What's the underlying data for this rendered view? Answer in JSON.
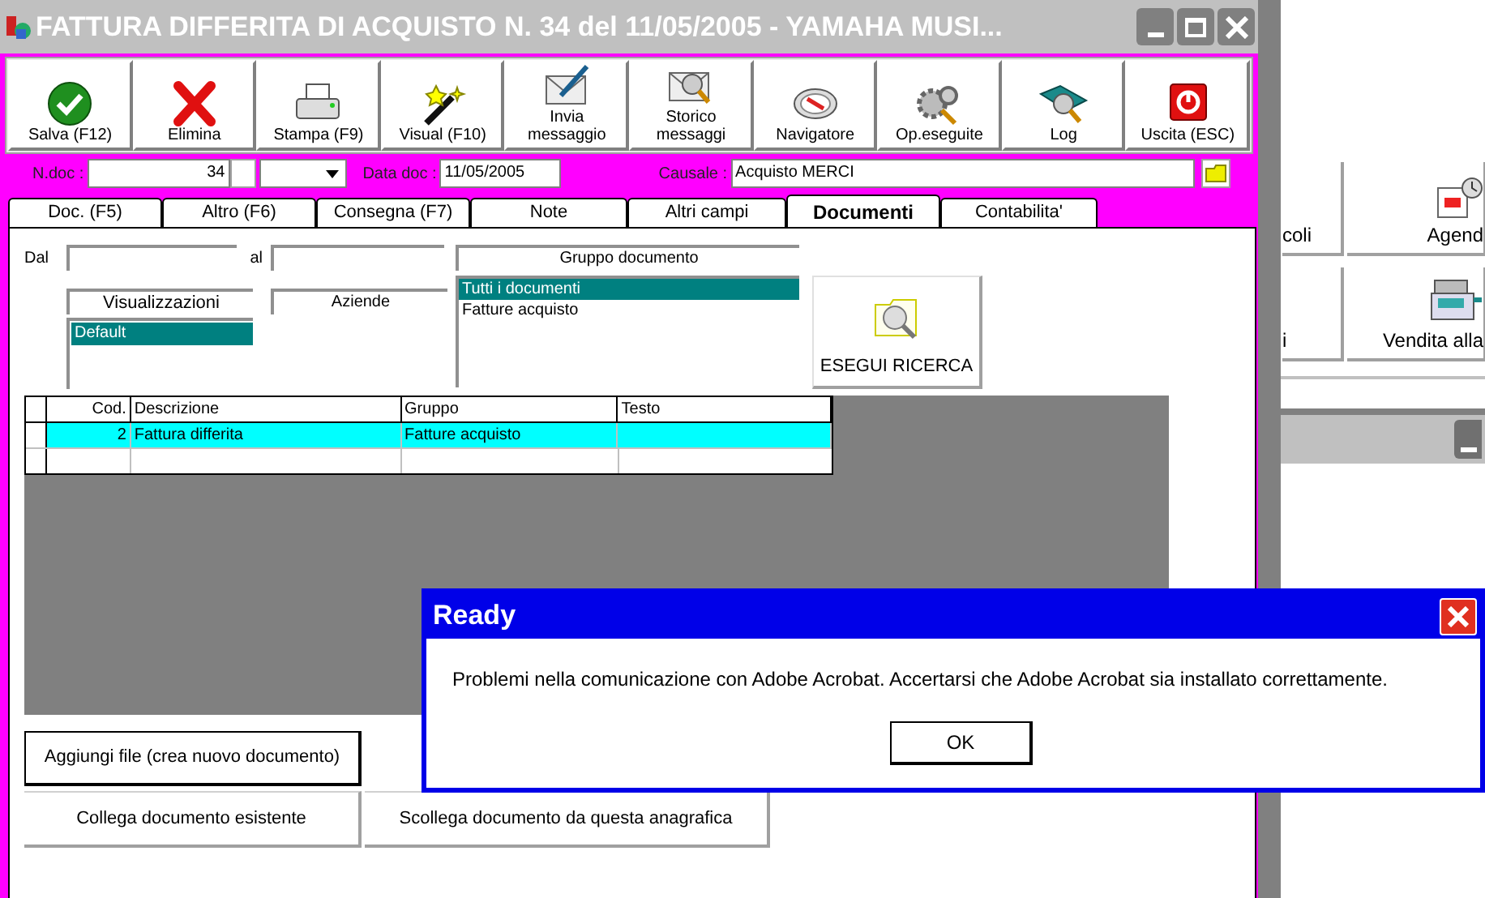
{
  "window": {
    "title": "FATTURA DIFFERITA DI ACQUISTO N. 34  del 11/05/2005 - YAMAHA MUSI..."
  },
  "toolbar": [
    {
      "label": "Salva (F12)",
      "kind": "check"
    },
    {
      "label": "Elimina",
      "kind": "cross"
    },
    {
      "label": "Stampa (F9)",
      "kind": "printer"
    },
    {
      "label": "Visual (F10)",
      "kind": "wand"
    },
    {
      "label": "Invia messaggio",
      "kind": "mail"
    },
    {
      "label": "Storico messaggi",
      "kind": "mailsearch"
    },
    {
      "label": "Navigatore",
      "kind": "compass"
    },
    {
      "label": "Op.eseguite",
      "kind": "gears"
    },
    {
      "label": "Log",
      "kind": "book"
    },
    {
      "label": "Uscita (ESC)",
      "kind": "power"
    }
  ],
  "header": {
    "ndoc_label": "N.doc :",
    "ndoc": "34",
    "date_label": "Data doc :",
    "date": "11/05/2005",
    "causale_label": "Causale :",
    "causale": "Acquisto MERCI"
  },
  "tabs": [
    {
      "label": "Doc. (F5)",
      "selected": false
    },
    {
      "label": "Altro (F6)",
      "selected": false
    },
    {
      "label": "Consegna (F7)",
      "selected": false
    },
    {
      "label": "Note",
      "selected": false
    },
    {
      "label": "Altri campi",
      "selected": false
    },
    {
      "label": "Documenti",
      "selected": true
    },
    {
      "label": "Contabilita'",
      "selected": false
    }
  ],
  "filters": {
    "from_label": "Dal",
    "to_label": "al",
    "views_header": "Visualizzazioni",
    "views": [
      {
        "label": "Default",
        "selected": true
      }
    ],
    "companies_header": "Aziende",
    "group_header": "Gruppo documento",
    "groups": [
      {
        "label": "Tutti i documenti",
        "selected": true
      },
      {
        "label": "Fatture acquisto",
        "selected": false
      }
    ],
    "search_button": "ESEGUI RICERCA"
  },
  "grid": {
    "columns": [
      "Cod.",
      "Descrizione",
      "Gruppo",
      "Testo"
    ],
    "rows": [
      {
        "cells": [
          "2",
          "Fattura differita",
          "Fatture acquisto",
          ""
        ],
        "selected": true
      }
    ]
  },
  "buttons": [
    "Aggiungi file (crea nuovo documento)",
    "Collega documento esistente",
    "Scollega documento da questa anagrafica"
  ],
  "background_window": {
    "buttons": [
      {
        "label": "coli",
        "kind": "plain"
      },
      {
        "label": "Agend",
        "kind": "calendar"
      },
      {
        "label": "i",
        "kind": "plain"
      },
      {
        "label": "Vendita alla",
        "kind": "register"
      }
    ]
  },
  "dialog": {
    "title": "Ready",
    "message": "Problemi nella comunicazione con Adobe Acrobat. Accertarsi che Adobe Acrobat sia installato correttamente.",
    "button": "OK"
  }
}
